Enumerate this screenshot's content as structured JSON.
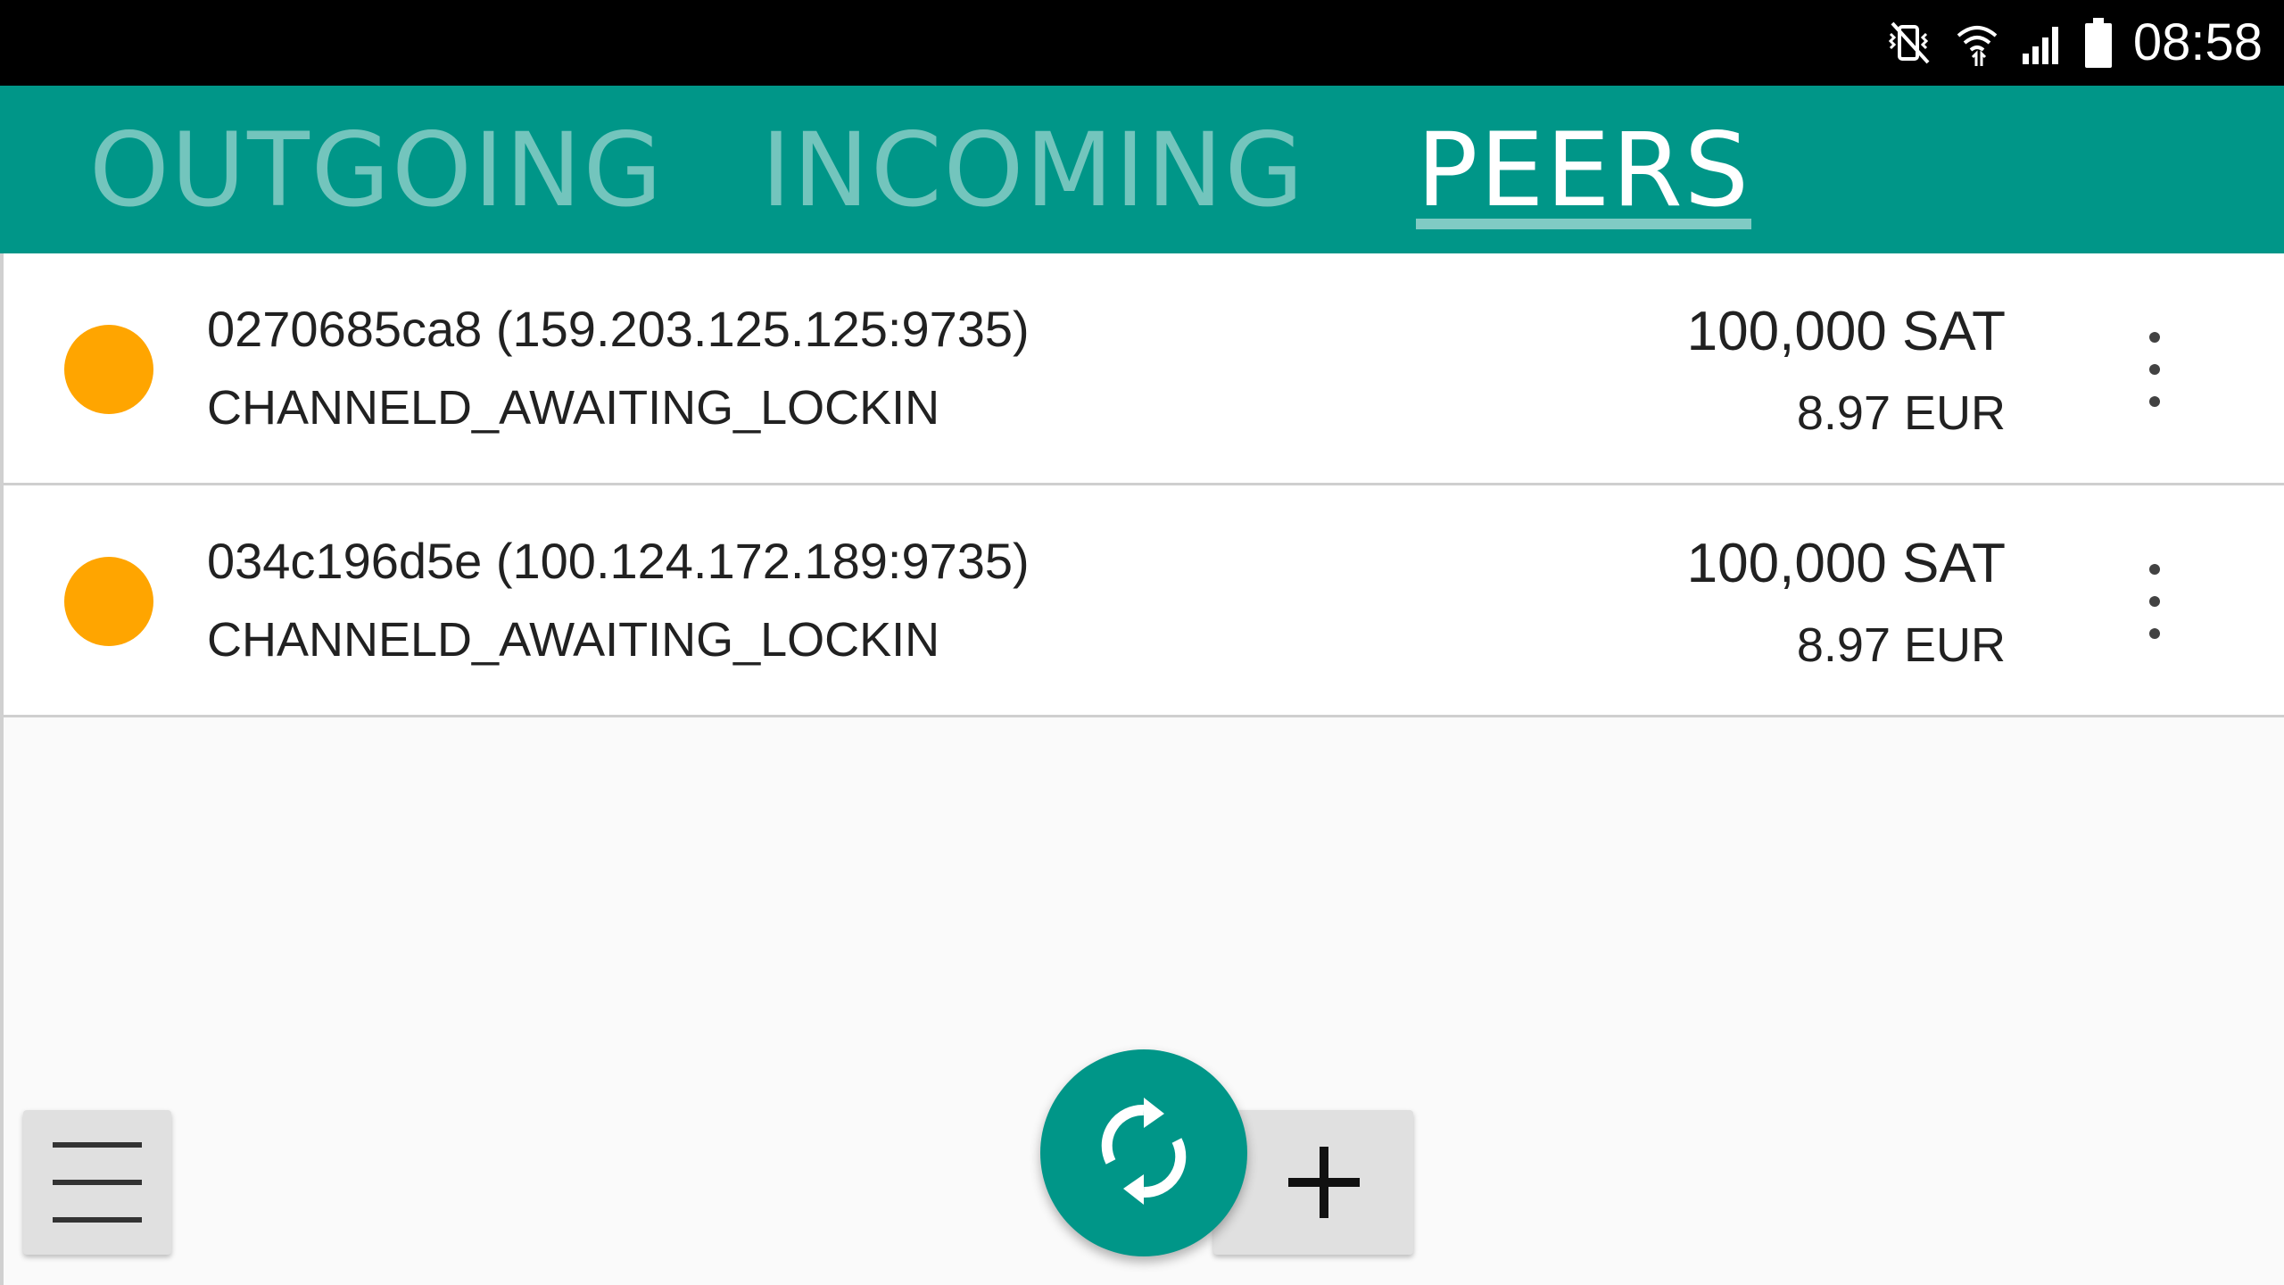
{
  "status_bar": {
    "time": "08:58",
    "icons": [
      "mute-vibrate-icon",
      "wifi-icon",
      "signal-icon",
      "battery-icon"
    ]
  },
  "tabs": [
    {
      "label": "OUTGOING",
      "active": false
    },
    {
      "label": "INCOMING",
      "active": false
    },
    {
      "label": "PEERS",
      "active": true
    }
  ],
  "peers": [
    {
      "id": "0270685ca8 (159.203.125.125:9735)",
      "state": "CHANNELD_AWAITING_LOCKIN",
      "amount_sat": "100,000 SAT",
      "amount_fiat": "8.97 EUR",
      "status_color": "#FFA500"
    },
    {
      "id": "034c196d5e (100.124.172.189:9735)",
      "state": "CHANNELD_AWAITING_LOCKIN",
      "amount_sat": "100,000 SAT",
      "amount_fiat": "8.97 EUR",
      "status_color": "#FFA500"
    }
  ],
  "colors": {
    "accent": "#009688",
    "tab_indicator": "#80CBC4",
    "pending_status": "#FFA500"
  },
  "controls": {
    "menu_icon": "hamburger-menu-icon",
    "refresh_icon": "refresh-icon",
    "add_icon": "plus-icon"
  }
}
